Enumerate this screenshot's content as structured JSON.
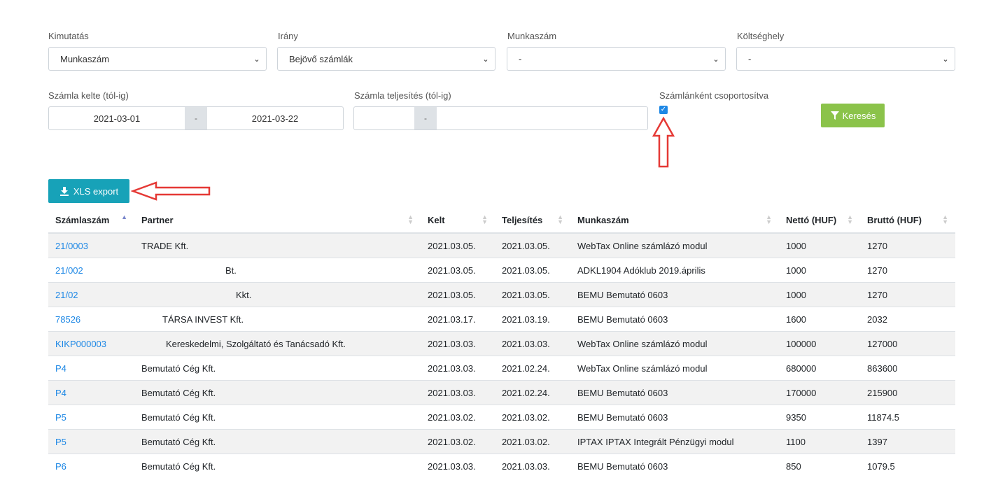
{
  "filters": {
    "kimutatas": {
      "label": "Kimutatás",
      "value": "Munkaszám"
    },
    "irany": {
      "label": "Irány",
      "value": "Bejövő számlák"
    },
    "munkaszam": {
      "label": "Munkaszám",
      "value": "-"
    },
    "koltseghely": {
      "label": "Költséghely",
      "value": "-"
    },
    "szamla_kelte": {
      "label": "Számla kelte (tól-ig)",
      "from": "2021-03-01",
      "sep": "-",
      "to": "2021-03-22"
    },
    "szamla_teljesites": {
      "label": "Számla teljesítés (tól-ig)",
      "from": "",
      "sep": "-",
      "to": ""
    },
    "csoportositva": {
      "label": "Számlánként csoportosítva",
      "checked": true
    },
    "search_label": "Keresés"
  },
  "export": {
    "label": "XLS export"
  },
  "table": {
    "headers": [
      "Számlaszám",
      "Partner",
      "Kelt",
      "Teljesítés",
      "Munkaszám",
      "Nettó (HUF)",
      "Bruttó (HUF)"
    ],
    "rows": [
      {
        "szam": "21/0003",
        "partner": "TRADE Kft.",
        "kelt": "2021.03.05.",
        "telj": "2021.03.05.",
        "munka": "WebTax Online számlázó modul",
        "netto": "1000",
        "brutto": "1270"
      },
      {
        "szam": "21/002",
        "partner": "Bt.",
        "kelt": "2021.03.05.",
        "telj": "2021.03.05.",
        "munka": "ADKL1904 Adóklub 2019.április",
        "netto": "1000",
        "brutto": "1270"
      },
      {
        "szam": "21/02",
        "partner": "Kkt.",
        "kelt": "2021.03.05.",
        "telj": "2021.03.05.",
        "munka": "BEMU Bemutató 0603",
        "netto": "1000",
        "brutto": "1270"
      },
      {
        "szam": "78526",
        "partner": "TÁRSA INVEST Kft.",
        "kelt": "2021.03.17.",
        "telj": "2021.03.19.",
        "munka": "BEMU Bemutató 0603",
        "netto": "1600",
        "brutto": "2032"
      },
      {
        "szam": "KIKP000003",
        "partner": "Kereskedelmi, Szolgáltató és Tanácsadó Kft.",
        "kelt": "2021.03.03.",
        "telj": "2021.03.03.",
        "munka": "WebTax Online számlázó modul",
        "netto": "100000",
        "brutto": "127000"
      },
      {
        "szam": "P4",
        "partner": "Bemutató Cég Kft.",
        "kelt": "2021.03.03.",
        "telj": "2021.02.24.",
        "munka": "WebTax Online számlázó modul",
        "netto": "680000",
        "brutto": "863600"
      },
      {
        "szam": "P4",
        "partner": "Bemutató Cég Kft.",
        "kelt": "2021.03.03.",
        "telj": "2021.02.24.",
        "munka": "BEMU Bemutató 0603",
        "netto": "170000",
        "brutto": "215900"
      },
      {
        "szam": "P5",
        "partner": "Bemutató Cég Kft.",
        "kelt": "2021.03.02.",
        "telj": "2021.03.02.",
        "munka": "BEMU Bemutató 0603",
        "netto": "9350",
        "brutto": "11874.5"
      },
      {
        "szam": "P5",
        "partner": "Bemutató Cég Kft.",
        "kelt": "2021.03.02.",
        "telj": "2021.03.02.",
        "munka": "IPTAX IPTAX Integrált Pénzügyi modul",
        "netto": "1100",
        "brutto": "1397"
      },
      {
        "szam": "P6",
        "partner": "Bemutató Cég Kft.",
        "kelt": "2021.03.03.",
        "telj": "2021.03.03.",
        "munka": "BEMU Bemutató 0603",
        "netto": "850",
        "brutto": "1079.5"
      }
    ]
  },
  "colors": {
    "accent": "#17a2b8",
    "search": "#8bc34a",
    "link": "#1e88e5",
    "annotation": "#e53935"
  }
}
